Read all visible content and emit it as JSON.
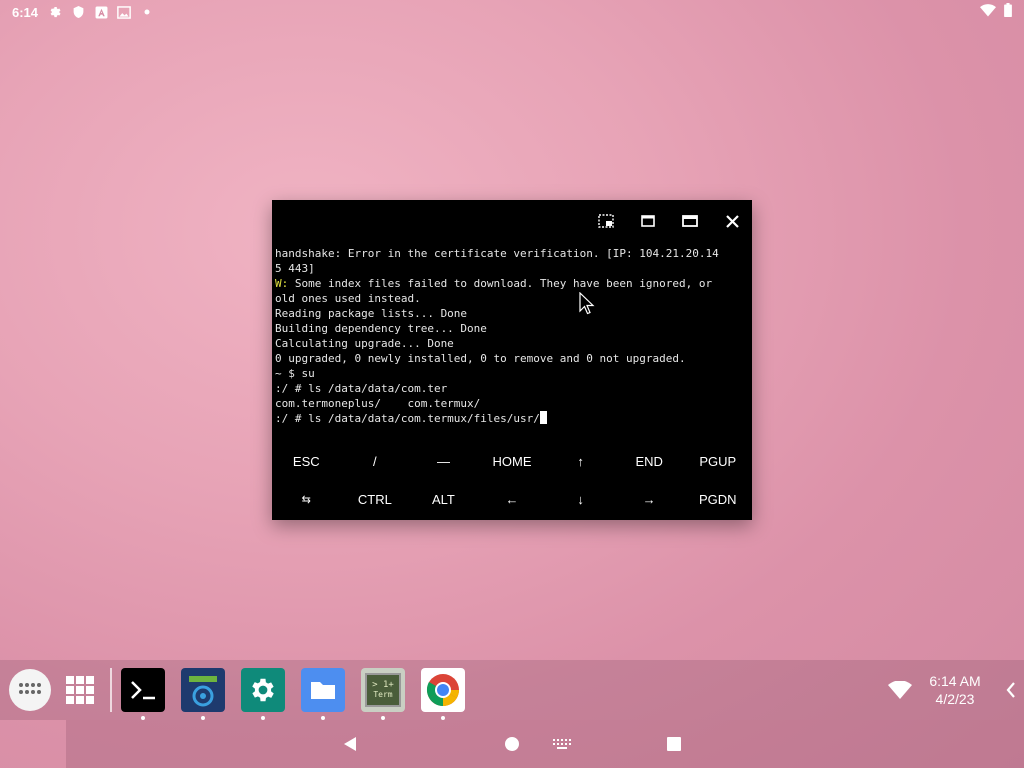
{
  "statusbar": {
    "time": "6:14",
    "icons": [
      "gear-icon",
      "shield-icon",
      "a-icon",
      "image-icon",
      "dot-icon"
    ],
    "right_icons": [
      "wifi-icon",
      "battery-icon"
    ]
  },
  "window": {
    "controls": [
      "screenshot-icon",
      "restore-icon",
      "maximize-icon",
      "close-icon"
    ],
    "terminal": {
      "lines": [
        "handshake: Error in the certificate verification. [IP: 104.21.20.14",
        "5 443]",
        "W: Some index files failed to download. They have been ignored, or",
        "old ones used instead.",
        "Reading package lists... Done",
        "Building dependency tree... Done",
        "Calculating upgrade... Done",
        "0 upgraded, 0 newly installed, 0 to remove and 0 not upgraded.",
        "~ $ su",
        ":/ # ls /data/data/com.ter",
        "com.termoneplus/    com.termux/",
        ":/ # ls /data/data/com.termux/files/usr/"
      ],
      "warn_prefix": "W:",
      "line3_rest": " Some index files failed to download. They have been ignored, or"
    },
    "keys_row1": [
      "ESC",
      "/",
      "—",
      "HOME",
      "↑",
      "END",
      "PGUP"
    ],
    "keys_row2": [
      "⇆",
      "CTRL",
      "ALT",
      "←",
      "↓",
      "→",
      "PGDN"
    ]
  },
  "taskbar": {
    "apps": [
      {
        "name": "terminal-app",
        "color": "#000000"
      },
      {
        "name": "android-terminal-app",
        "color": "#1e3a6e"
      },
      {
        "name": "settings-app",
        "color": "#0f8a7a"
      },
      {
        "name": "files-app",
        "color": "#4d8ef0"
      },
      {
        "name": "term-app",
        "color": "#c9cfc3"
      },
      {
        "name": "chrome-app",
        "color": "#ffffff"
      }
    ],
    "term_icon_text": "> 1+",
    "term_icon_sub": "Term",
    "clock_time": "6:14 AM",
    "clock_date": "4/2/23"
  },
  "colors": {
    "accent_warn": "#e0e040"
  }
}
